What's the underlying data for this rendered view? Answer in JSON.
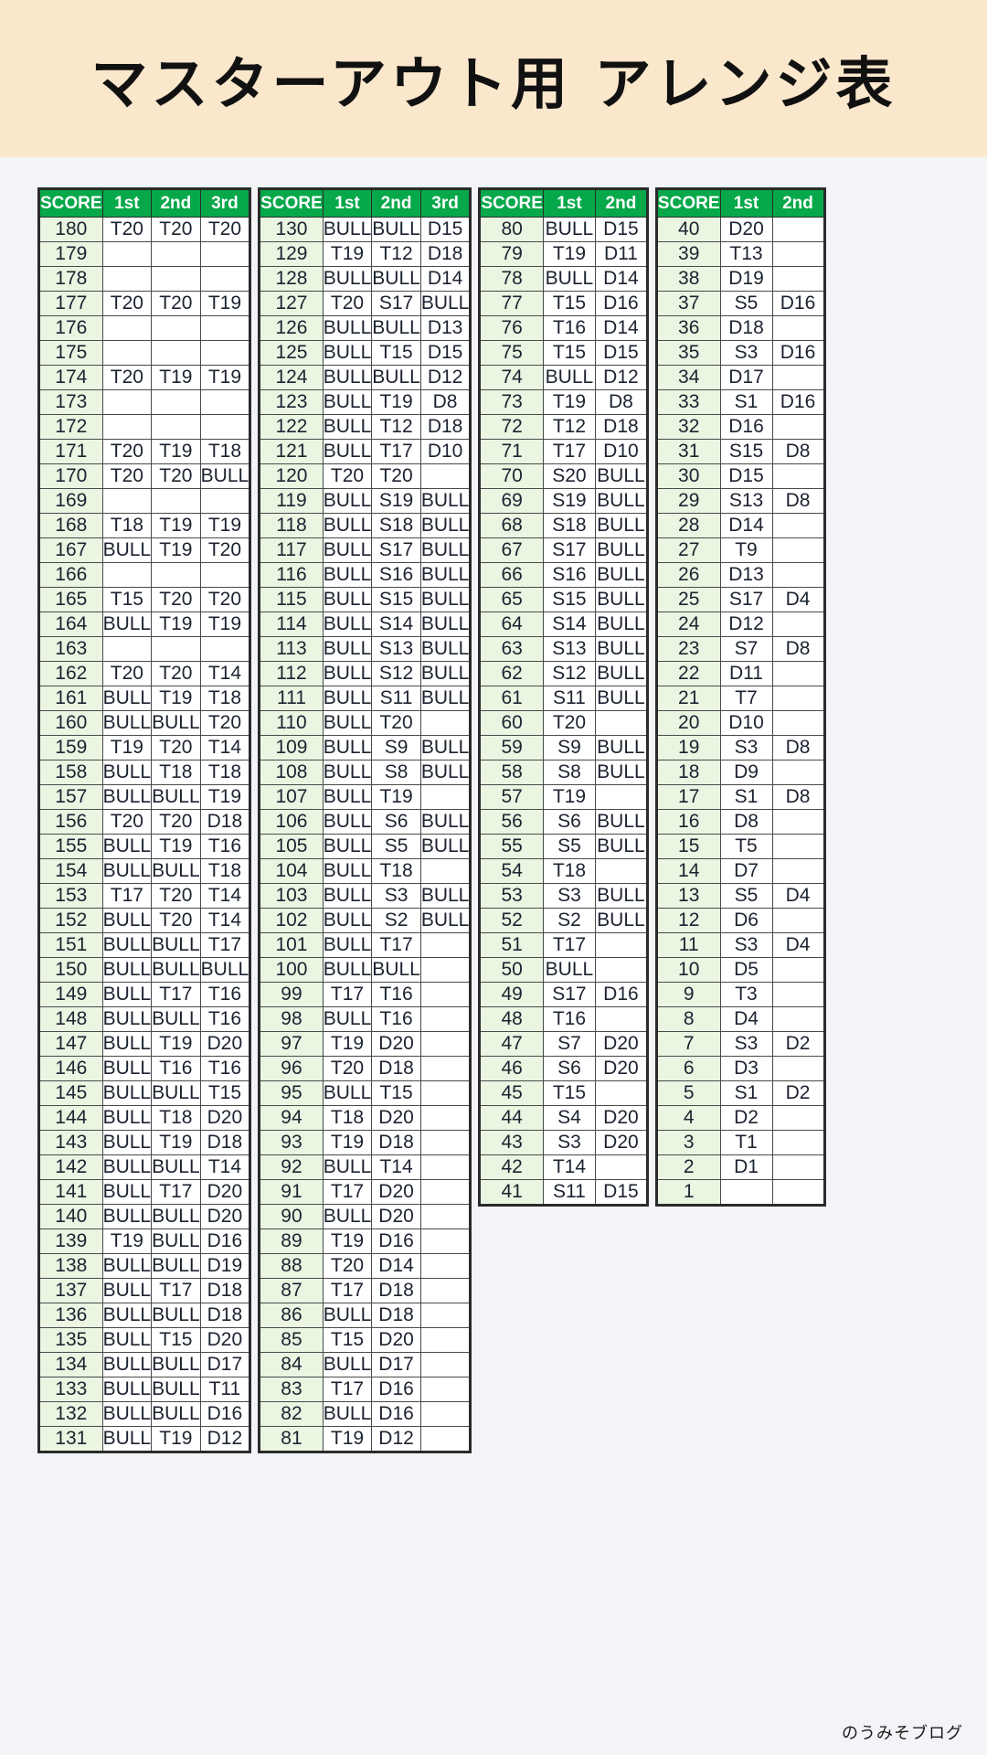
{
  "header": {
    "title": "マスターアウト用 アレンジ表",
    "band_color": "#fbe8cc"
  },
  "footer": {
    "credit": "のうみそブログ"
  },
  "theme": {
    "header_cell_color": "#06a84a",
    "score_cell_color": "#eaf5e2",
    "page_background": "#f2f4f7",
    "border_color": "#2b2b2b"
  },
  "tables": [
    {
      "id": "table-180-131",
      "columns": [
        "SCORE",
        "1st",
        "2nd",
        "3rd"
      ],
      "rows": [
        [
          "180",
          "T20",
          "T20",
          "T20"
        ],
        [
          "179",
          "",
          "",
          ""
        ],
        [
          "178",
          "",
          "",
          ""
        ],
        [
          "177",
          "T20",
          "T20",
          "T19"
        ],
        [
          "176",
          "",
          "",
          ""
        ],
        [
          "175",
          "",
          "",
          ""
        ],
        [
          "174",
          "T20",
          "T19",
          "T19"
        ],
        [
          "173",
          "",
          "",
          ""
        ],
        [
          "172",
          "",
          "",
          ""
        ],
        [
          "171",
          "T20",
          "T19",
          "T18"
        ],
        [
          "170",
          "T20",
          "T20",
          "BULL"
        ],
        [
          "169",
          "",
          "",
          ""
        ],
        [
          "168",
          "T18",
          "T19",
          "T19"
        ],
        [
          "167",
          "BULL",
          "T19",
          "T20"
        ],
        [
          "166",
          "",
          "",
          ""
        ],
        [
          "165",
          "T15",
          "T20",
          "T20"
        ],
        [
          "164",
          "BULL",
          "T19",
          "T19"
        ],
        [
          "163",
          "",
          "",
          ""
        ],
        [
          "162",
          "T20",
          "T20",
          "T14"
        ],
        [
          "161",
          "BULL",
          "T19",
          "T18"
        ],
        [
          "160",
          "BULL",
          "BULL",
          "T20"
        ],
        [
          "159",
          "T19",
          "T20",
          "T14"
        ],
        [
          "158",
          "BULL",
          "T18",
          "T18"
        ],
        [
          "157",
          "BULL",
          "BULL",
          "T19"
        ],
        [
          "156",
          "T20",
          "T20",
          "D18"
        ],
        [
          "155",
          "BULL",
          "T19",
          "T16"
        ],
        [
          "154",
          "BULL",
          "BULL",
          "T18"
        ],
        [
          "153",
          "T17",
          "T20",
          "T14"
        ],
        [
          "152",
          "BULL",
          "T20",
          "T14"
        ],
        [
          "151",
          "BULL",
          "BULL",
          "T17"
        ],
        [
          "150",
          "BULL",
          "BULL",
          "BULL"
        ],
        [
          "149",
          "BULL",
          "T17",
          "T16"
        ],
        [
          "148",
          "BULL",
          "BULL",
          "T16"
        ],
        [
          "147",
          "BULL",
          "T19",
          "D20"
        ],
        [
          "146",
          "BULL",
          "T16",
          "T16"
        ],
        [
          "145",
          "BULL",
          "BULL",
          "T15"
        ],
        [
          "144",
          "BULL",
          "T18",
          "D20"
        ],
        [
          "143",
          "BULL",
          "T19",
          "D18"
        ],
        [
          "142",
          "BULL",
          "BULL",
          "T14"
        ],
        [
          "141",
          "BULL",
          "T17",
          "D20"
        ],
        [
          "140",
          "BULL",
          "BULL",
          "D20"
        ],
        [
          "139",
          "T19",
          "BULL",
          "D16"
        ],
        [
          "138",
          "BULL",
          "BULL",
          "D19"
        ],
        [
          "137",
          "BULL",
          "T17",
          "D18"
        ],
        [
          "136",
          "BULL",
          "BULL",
          "D18"
        ],
        [
          "135",
          "BULL",
          "T15",
          "D20"
        ],
        [
          "134",
          "BULL",
          "BULL",
          "D17"
        ],
        [
          "133",
          "BULL",
          "BULL",
          "T11"
        ],
        [
          "132",
          "BULL",
          "BULL",
          "D16"
        ],
        [
          "131",
          "BULL",
          "T19",
          "D12"
        ]
      ]
    },
    {
      "id": "table-130-81",
      "columns": [
        "SCORE",
        "1st",
        "2nd",
        "3rd"
      ],
      "rows": [
        [
          "130",
          "BULL",
          "BULL",
          "D15"
        ],
        [
          "129",
          "T19",
          "T12",
          "D18"
        ],
        [
          "128",
          "BULL",
          "BULL",
          "D14"
        ],
        [
          "127",
          "T20",
          "S17",
          "BULL"
        ],
        [
          "126",
          "BULL",
          "BULL",
          "D13"
        ],
        [
          "125",
          "BULL",
          "T15",
          "D15"
        ],
        [
          "124",
          "BULL",
          "BULL",
          "D12"
        ],
        [
          "123",
          "BULL",
          "T19",
          "D8"
        ],
        [
          "122",
          "BULL",
          "T12",
          "D18"
        ],
        [
          "121",
          "BULL",
          "T17",
          "D10"
        ],
        [
          "120",
          "T20",
          "T20",
          ""
        ],
        [
          "119",
          "BULL",
          "S19",
          "BULL"
        ],
        [
          "118",
          "BULL",
          "S18",
          "BULL"
        ],
        [
          "117",
          "BULL",
          "S17",
          "BULL"
        ],
        [
          "116",
          "BULL",
          "S16",
          "BULL"
        ],
        [
          "115",
          "BULL",
          "S15",
          "BULL"
        ],
        [
          "114",
          "BULL",
          "S14",
          "BULL"
        ],
        [
          "113",
          "BULL",
          "S13",
          "BULL"
        ],
        [
          "112",
          "BULL",
          "S12",
          "BULL"
        ],
        [
          "111",
          "BULL",
          "S11",
          "BULL"
        ],
        [
          "110",
          "BULL",
          "T20",
          ""
        ],
        [
          "109",
          "BULL",
          "S9",
          "BULL"
        ],
        [
          "108",
          "BULL",
          "S8",
          "BULL"
        ],
        [
          "107",
          "BULL",
          "T19",
          ""
        ],
        [
          "106",
          "BULL",
          "S6",
          "BULL"
        ],
        [
          "105",
          "BULL",
          "S5",
          "BULL"
        ],
        [
          "104",
          "BULL",
          "T18",
          ""
        ],
        [
          "103",
          "BULL",
          "S3",
          "BULL"
        ],
        [
          "102",
          "BULL",
          "S2",
          "BULL"
        ],
        [
          "101",
          "BULL",
          "T17",
          ""
        ],
        [
          "100",
          "BULL",
          "BULL",
          ""
        ],
        [
          "99",
          "T17",
          "T16",
          ""
        ],
        [
          "98",
          "BULL",
          "T16",
          ""
        ],
        [
          "97",
          "T19",
          "D20",
          ""
        ],
        [
          "96",
          "T20",
          "D18",
          ""
        ],
        [
          "95",
          "BULL",
          "T15",
          ""
        ],
        [
          "94",
          "T18",
          "D20",
          ""
        ],
        [
          "93",
          "T19",
          "D18",
          ""
        ],
        [
          "92",
          "BULL",
          "T14",
          ""
        ],
        [
          "91",
          "T17",
          "D20",
          ""
        ],
        [
          "90",
          "BULL",
          "D20",
          ""
        ],
        [
          "89",
          "T19",
          "D16",
          ""
        ],
        [
          "88",
          "T20",
          "D14",
          ""
        ],
        [
          "87",
          "T17",
          "D18",
          ""
        ],
        [
          "86",
          "BULL",
          "D18",
          ""
        ],
        [
          "85",
          "T15",
          "D20",
          ""
        ],
        [
          "84",
          "BULL",
          "D17",
          ""
        ],
        [
          "83",
          "T17",
          "D16",
          ""
        ],
        [
          "82",
          "BULL",
          "D16",
          ""
        ],
        [
          "81",
          "T19",
          "D12",
          ""
        ]
      ]
    },
    {
      "id": "table-80-41",
      "columns": [
        "SCORE",
        "1st",
        "2nd"
      ],
      "rows": [
        [
          "80",
          "BULL",
          "D15"
        ],
        [
          "79",
          "T19",
          "D11"
        ],
        [
          "78",
          "BULL",
          "D14"
        ],
        [
          "77",
          "T15",
          "D16"
        ],
        [
          "76",
          "T16",
          "D14"
        ],
        [
          "75",
          "T15",
          "D15"
        ],
        [
          "74",
          "BULL",
          "D12"
        ],
        [
          "73",
          "T19",
          "D8"
        ],
        [
          "72",
          "T12",
          "D18"
        ],
        [
          "71",
          "T17",
          "D10"
        ],
        [
          "70",
          "S20",
          "BULL"
        ],
        [
          "69",
          "S19",
          "BULL"
        ],
        [
          "68",
          "S18",
          "BULL"
        ],
        [
          "67",
          "S17",
          "BULL"
        ],
        [
          "66",
          "S16",
          "BULL"
        ],
        [
          "65",
          "S15",
          "BULL"
        ],
        [
          "64",
          "S14",
          "BULL"
        ],
        [
          "63",
          "S13",
          "BULL"
        ],
        [
          "62",
          "S12",
          "BULL"
        ],
        [
          "61",
          "S11",
          "BULL"
        ],
        [
          "60",
          "T20",
          ""
        ],
        [
          "59",
          "S9",
          "BULL"
        ],
        [
          "58",
          "S8",
          "BULL"
        ],
        [
          "57",
          "T19",
          ""
        ],
        [
          "56",
          "S6",
          "BULL"
        ],
        [
          "55",
          "S5",
          "BULL"
        ],
        [
          "54",
          "T18",
          ""
        ],
        [
          "53",
          "S3",
          "BULL"
        ],
        [
          "52",
          "S2",
          "BULL"
        ],
        [
          "51",
          "T17",
          ""
        ],
        [
          "50",
          "BULL",
          ""
        ],
        [
          "49",
          "S17",
          "D16"
        ],
        [
          "48",
          "T16",
          ""
        ],
        [
          "47",
          "S7",
          "D20"
        ],
        [
          "46",
          "S6",
          "D20"
        ],
        [
          "45",
          "T15",
          ""
        ],
        [
          "44",
          "S4",
          "D20"
        ],
        [
          "43",
          "S3",
          "D20"
        ],
        [
          "42",
          "T14",
          ""
        ],
        [
          "41",
          "S11",
          "D15"
        ]
      ]
    },
    {
      "id": "table-40-1",
      "columns": [
        "SCORE",
        "1st",
        "2nd"
      ],
      "rows": [
        [
          "40",
          "D20",
          ""
        ],
        [
          "39",
          "T13",
          ""
        ],
        [
          "38",
          "D19",
          ""
        ],
        [
          "37",
          "S5",
          "D16"
        ],
        [
          "36",
          "D18",
          ""
        ],
        [
          "35",
          "S3",
          "D16"
        ],
        [
          "34",
          "D17",
          ""
        ],
        [
          "33",
          "S1",
          "D16"
        ],
        [
          "32",
          "D16",
          ""
        ],
        [
          "31",
          "S15",
          "D8"
        ],
        [
          "30",
          "D15",
          ""
        ],
        [
          "29",
          "S13",
          "D8"
        ],
        [
          "28",
          "D14",
          ""
        ],
        [
          "27",
          "T9",
          ""
        ],
        [
          "26",
          "D13",
          ""
        ],
        [
          "25",
          "S17",
          "D4"
        ],
        [
          "24",
          "D12",
          ""
        ],
        [
          "23",
          "S7",
          "D8"
        ],
        [
          "22",
          "D11",
          ""
        ],
        [
          "21",
          "T7",
          ""
        ],
        [
          "20",
          "D10",
          ""
        ],
        [
          "19",
          "S3",
          "D8"
        ],
        [
          "18",
          "D9",
          ""
        ],
        [
          "17",
          "S1",
          "D8"
        ],
        [
          "16",
          "D8",
          ""
        ],
        [
          "15",
          "T5",
          ""
        ],
        [
          "14",
          "D7",
          ""
        ],
        [
          "13",
          "S5",
          "D4"
        ],
        [
          "12",
          "D6",
          ""
        ],
        [
          "11",
          "S3",
          "D4"
        ],
        [
          "10",
          "D5",
          ""
        ],
        [
          "9",
          "T3",
          ""
        ],
        [
          "8",
          "D4",
          ""
        ],
        [
          "7",
          "S3",
          "D2"
        ],
        [
          "6",
          "D3",
          ""
        ],
        [
          "5",
          "S1",
          "D2"
        ],
        [
          "4",
          "D2",
          ""
        ],
        [
          "3",
          "T1",
          ""
        ],
        [
          "2",
          "D1",
          ""
        ],
        [
          "1",
          "",
          ""
        ]
      ]
    }
  ]
}
